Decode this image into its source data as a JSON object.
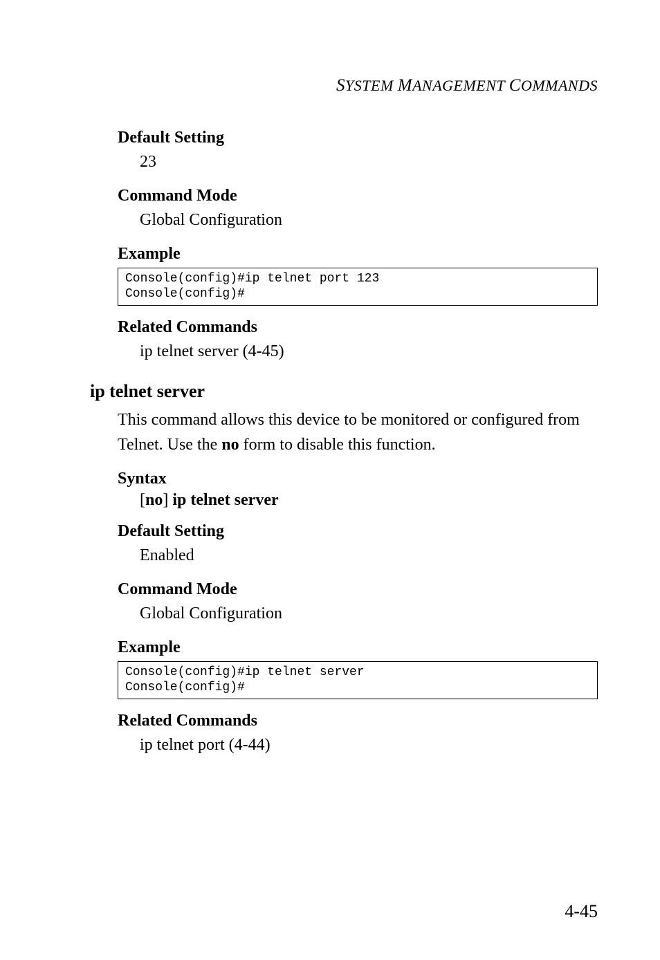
{
  "header": {
    "running": "SYSTEM MANAGEMENT COMMANDS"
  },
  "sec1": {
    "h_default": "Default Setting",
    "default_val": "23",
    "h_mode": "Command Mode",
    "mode_val": "Global Configuration",
    "h_example": "Example",
    "code": "Console(config)#ip telnet port 123\nConsole(config)#",
    "h_related": "Related Commands",
    "related_val": "ip telnet server (4-45)"
  },
  "sec2": {
    "title": "ip telnet server",
    "desc_pre": "This command allows this device to be monitored or configured from Telnet. Use the ",
    "desc_bold": "no",
    "desc_post": " form to disable this function.",
    "h_syntax": "Syntax",
    "syntax_pre": "[",
    "syntax_no": "no",
    "syntax_mid": "] ",
    "syntax_cmd": "ip telnet server",
    "h_default": "Default Setting",
    "default_val": "Enabled",
    "h_mode": "Command Mode",
    "mode_val": "Global Configuration",
    "h_example": "Example",
    "code": "Console(config)#ip telnet server\nConsole(config)#",
    "h_related": "Related Commands",
    "related_val": "ip telnet port (4-44)"
  },
  "footer": {
    "page": "4-45"
  }
}
